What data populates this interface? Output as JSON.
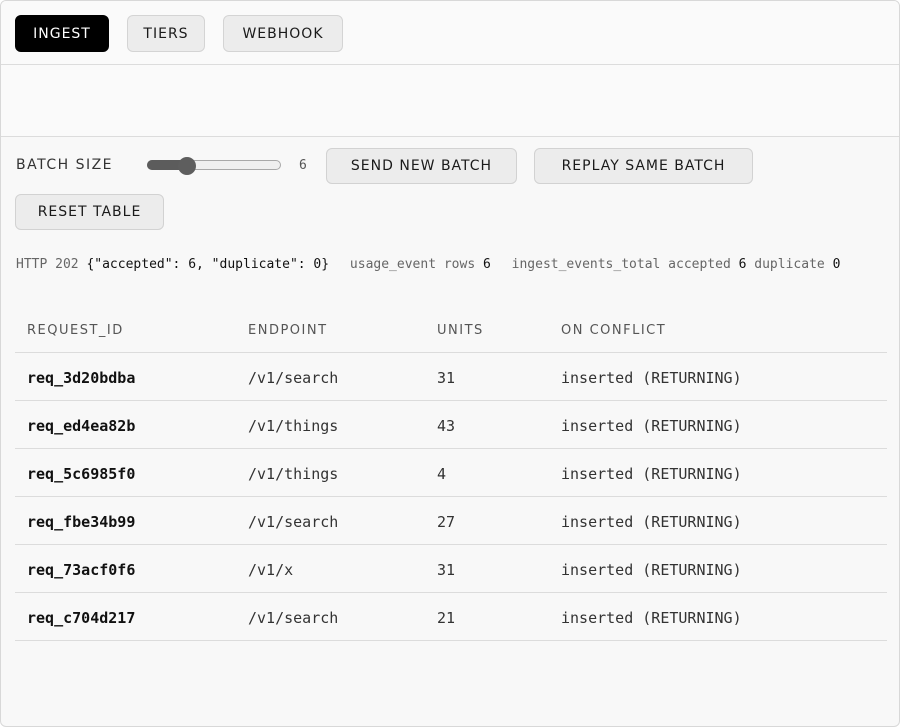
{
  "tabs": [
    {
      "label": "INGEST",
      "active": true
    },
    {
      "label": "TIERS",
      "active": false
    },
    {
      "label": "WEBHOOK",
      "active": false
    }
  ],
  "controls": {
    "batch_size_label": "BATCH SIZE",
    "batch_size_value": "6",
    "batch_size_fraction": 0.3,
    "send_label": "SEND NEW BATCH",
    "replay_label": "REPLAY SAME BATCH",
    "reset_label": "RESET TABLE"
  },
  "status": {
    "http": "HTTP 202",
    "body": "{\"accepted\": 6, \"duplicate\": 0}",
    "rows_label": "usage_event rows",
    "rows_value": "6",
    "metric_label": "ingest_events_total accepted",
    "accepted_value": "6",
    "duplicate_label": "duplicate",
    "duplicate_value": "0"
  },
  "table": {
    "headers": [
      "REQUEST_ID",
      "ENDPOINT",
      "UNITS",
      "ON CONFLICT"
    ],
    "rows": [
      [
        "req_3d20bdba",
        "/v1/search",
        "31",
        "inserted (RETURNING)"
      ],
      [
        "req_ed4ea82b",
        "/v1/things",
        "43",
        "inserted (RETURNING)"
      ],
      [
        "req_5c6985f0",
        "/v1/things",
        "4",
        "inserted (RETURNING)"
      ],
      [
        "req_fbe34b99",
        "/v1/search",
        "27",
        "inserted (RETURNING)"
      ],
      [
        "req_73acf0f6",
        "/v1/x",
        "31",
        "inserted (RETURNING)"
      ],
      [
        "req_c704d217",
        "/v1/search",
        "21",
        "inserted (RETURNING)"
      ]
    ]
  }
}
